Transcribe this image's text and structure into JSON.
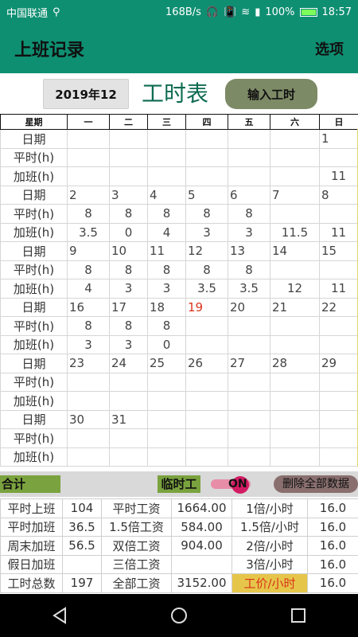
{
  "status": {
    "carrier": "中国联通",
    "speed": "168B/s",
    "battery": "100%",
    "time": "18:57"
  },
  "app": {
    "title": "上班记录",
    "options": "选项"
  },
  "controls": {
    "month": "2019年12",
    "sheet_title": "工时表",
    "input_button": "输入工时"
  },
  "weekdays": [
    "星期",
    "一",
    "二",
    "三",
    "四",
    "五",
    "六",
    "日"
  ],
  "calendar": {
    "labels": [
      "日期",
      "平时(h)",
      "加班(h)"
    ],
    "weeks": [
      {
        "dates": [
          "",
          "",
          "",
          "",
          "",
          "",
          "1"
        ],
        "normal": [
          "",
          "",
          "",
          "",
          "",
          "",
          ""
        ],
        "overtime": [
          "",
          "",
          "",
          "",
          "",
          "",
          "11"
        ]
      },
      {
        "dates": [
          "2",
          "3",
          "4",
          "5",
          "6",
          "7",
          "8"
        ],
        "normal": [
          "8",
          "8",
          "8",
          "8",
          "8",
          "",
          ""
        ],
        "overtime": [
          "3.5",
          "0",
          "4",
          "3",
          "3",
          "11.5",
          "11"
        ]
      },
      {
        "dates": [
          "9",
          "10",
          "11",
          "12",
          "13",
          "14",
          "15"
        ],
        "normal": [
          "8",
          "8",
          "8",
          "8",
          "8",
          "",
          ""
        ],
        "overtime": [
          "4",
          "3",
          "3",
          "3.5",
          "3.5",
          "12",
          "11"
        ]
      },
      {
        "dates": [
          "16",
          "17",
          "18",
          "19",
          "20",
          "21",
          "22"
        ],
        "normal": [
          "8",
          "8",
          "8",
          "",
          "",
          "",
          ""
        ],
        "overtime": [
          "3",
          "3",
          "0",
          "",
          "",
          "",
          ""
        ]
      },
      {
        "dates": [
          "23",
          "24",
          "25",
          "26",
          "27",
          "28",
          "29"
        ],
        "normal": [
          "",
          "",
          "",
          "",
          "",
          "",
          ""
        ],
        "overtime": [
          "",
          "",
          "",
          "",
          "",
          "",
          ""
        ]
      },
      {
        "dates": [
          "30",
          "31",
          "",
          "",
          "",
          "",
          ""
        ],
        "normal": [
          "",
          "",
          "",
          "",
          "",
          "",
          ""
        ],
        "overtime": [
          "",
          "",
          "",
          "",
          "",
          "",
          ""
        ]
      }
    ]
  },
  "summary_bar": {
    "total": "合计",
    "temp": "临时工",
    "toggle": "ON",
    "delete": "删除全部数据"
  },
  "summary": [
    [
      "平时上班",
      "104",
      "平时工资",
      "1664.00",
      "1倍/小时",
      "16.0"
    ],
    [
      "平时加班",
      "36.5",
      "1.5倍工资",
      "584.00",
      "1.5倍/小时",
      "16.0"
    ],
    [
      "周末加班",
      "56.5",
      "双倍工资",
      "904.00",
      "2倍/小时",
      "16.0"
    ],
    [
      "假日加班",
      "",
      "三倍工资",
      "",
      "3倍/小时",
      "16.0"
    ],
    [
      "工时总数",
      "197",
      "全部工资",
      "3152.00",
      "工价/小时",
      "16.0"
    ]
  ],
  "colors": {
    "accent": "#0f8f72",
    "today": "#d9341a"
  }
}
